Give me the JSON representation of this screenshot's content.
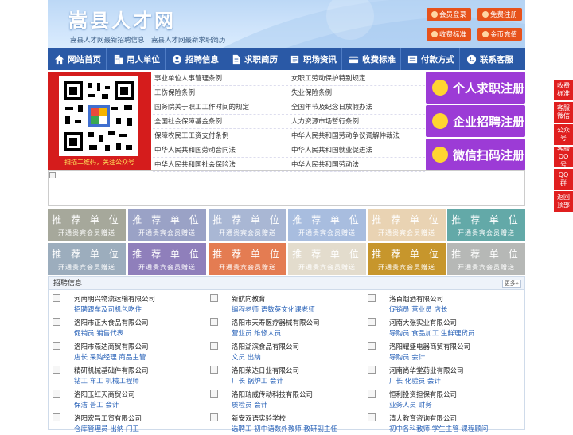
{
  "header": {
    "title": "嵩县人才网",
    "subtitle": "嵩县人才网最新招聘信息　嵩县人才网最新求职简历",
    "buttons": [
      {
        "label": "会员登录",
        "icon": "user-icon"
      },
      {
        "label": "免费注册",
        "icon": "register-icon"
      },
      {
        "label": "收费标准",
        "icon": "price-icon"
      },
      {
        "label": "金币充值",
        "icon": "coin-icon"
      }
    ]
  },
  "nav": [
    {
      "label": "网站首页",
      "icon": "home-icon"
    },
    {
      "label": "用人单位",
      "icon": "building-icon"
    },
    {
      "label": "招聘信息",
      "icon": "recruit-icon"
    },
    {
      "label": "求职简历",
      "icon": "resume-icon"
    },
    {
      "label": "职场资讯",
      "icon": "news-icon"
    },
    {
      "label": "收费标准",
      "icon": "price-icon"
    },
    {
      "label": "付款方式",
      "icon": "payment-icon"
    },
    {
      "label": "联系客服",
      "icon": "phone-icon"
    }
  ],
  "qr": {
    "caption": "扫描二维码，关注公众号"
  },
  "links": {
    "left": [
      "事业单位人事管理条例",
      "工伤保险条例",
      "国务院关于职工工作时间的规定",
      "全国社会保障基金条例",
      "保障农民工工资支付条例",
      "中华人民共和国劳动合同法",
      "中华人民共和国社会保险法"
    ],
    "right": [
      "女职工劳动保护特别规定",
      "失业保险条例",
      "全国年节及纪念日放假办法",
      "人力资源市场暂行条例",
      "中华人民共和国劳动争议调解仲裁法",
      "中华人民共和国就业促进法",
      "中华人民共和国劳动法"
    ]
  },
  "register": [
    {
      "label": "个人求职注册",
      "icon": "person-icon"
    },
    {
      "label": "企业招聘注册",
      "icon": "company-icon"
    },
    {
      "label": "微信扫码注册",
      "icon": "wechat-icon"
    }
  ],
  "tiles": {
    "title": "推 荐 单 位",
    "sub": "开通贵宾会员赠送",
    "colors": [
      "#a6a89b",
      "#9aa2c6",
      "#a9b7d4",
      "#a8bddf",
      "#e9d3b3",
      "#63a9a8",
      "#9cadbd",
      "#8f7fbb",
      "#e47c52",
      "#e3dccd",
      "#c7962c",
      "#b6b8b6"
    ]
  },
  "jobs": {
    "title": "招聘信息",
    "more": "更多»",
    "rows": [
      [
        {
          "company": "河南明兴物流运输有限公司",
          "positions": "招聘跟车及司机包吃住"
        },
        {
          "company": "新航向教育",
          "positions": "编程老师 语数英文化课老师"
        },
        {
          "company": "洛百烟酒有限公司",
          "positions": "促销员 营业员 店长"
        }
      ],
      [
        {
          "company": "洛阳市正大食品有限公司",
          "positions": "促销员 销售代表"
        },
        {
          "company": "洛阳市天寿医疗器械有限公司",
          "positions": "营业员 维修人员"
        },
        {
          "company": "河南大张实业有限公司",
          "positions": "导购员 食品加工 生鲜理货员"
        }
      ],
      [
        {
          "company": "洛阳市燕达商贸有限公司",
          "positions": "店长 采购经理 商品主管"
        },
        {
          "company": "洛阳湖滨食品有限公司",
          "positions": "文员 出纳"
        },
        {
          "company": "洛阳耀盛电器商贸有限公司",
          "positions": "导购员 会计"
        }
      ],
      [
        {
          "company": "精研机械基础件有限公司",
          "positions": "钻工 车工 机械工程师"
        },
        {
          "company": "洛阳荣达日业有限公司",
          "positions": "厂长 锅炉工 会计"
        },
        {
          "company": "河南尚华堂药业有限公司",
          "positions": "厂长 化验员 会计"
        }
      ],
      [
        {
          "company": "洛阳玉红天商贸公司",
          "positions": "保洁 普工 会计"
        },
        {
          "company": "洛阳瑞威传动科技有限公司",
          "positions": "质检员 会计"
        },
        {
          "company": "恒利投资担保有限公司",
          "positions": "业务人员 财务"
        }
      ],
      [
        {
          "company": "洛阳宏昌工贸有限公司",
          "positions": "仓库管理员 出纳 门卫"
        },
        {
          "company": "新安双语实验学校",
          "positions": "选聘工 初中语数外教师 教研副主任"
        },
        {
          "company": "清大教育咨询有限公司",
          "positions": "初中各科教师 学生主管 课程顾问"
        }
      ]
    ]
  },
  "float": [
    "收费标准",
    "客服微信",
    "公众号",
    "客服QQ号",
    "QQ群",
    "返回顶部"
  ]
}
